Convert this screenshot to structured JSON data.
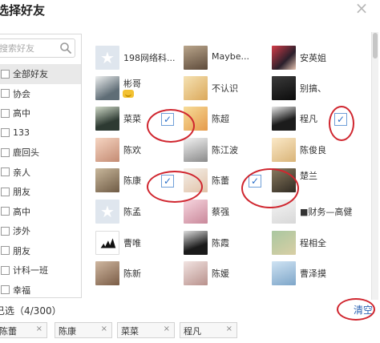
{
  "dialog": {
    "title": "选择好友",
    "close_label": "×"
  },
  "search": {
    "placeholder": "搜索好友"
  },
  "groups": [
    {
      "label": "全部好友"
    },
    {
      "label": "协会"
    },
    {
      "label": "高中"
    },
    {
      "label": "133"
    },
    {
      "label": "鹿回头"
    },
    {
      "label": "亲人"
    },
    {
      "label": "朋友"
    },
    {
      "label": "高中"
    },
    {
      "label": "涉外"
    },
    {
      "label": "朋友"
    },
    {
      "label": "计科一班"
    },
    {
      "label": "幸福"
    }
  ],
  "friends": [
    {
      "name": "198网络科..."
    },
    {
      "name": "Maybe..."
    },
    {
      "name": "安英姐"
    },
    {
      "name": "彬哥"
    },
    {
      "name": "不认识"
    },
    {
      "name": "别搞、"
    },
    {
      "name": "菜菜"
    },
    {
      "name": "陈超"
    },
    {
      "name": "程凡"
    },
    {
      "name": "陈欢"
    },
    {
      "name": "陈江波"
    },
    {
      "name": "陈俊良"
    },
    {
      "name": "陈康"
    },
    {
      "name": "陈蕾"
    },
    {
      "name": "楚兰"
    },
    {
      "name": "陈孟"
    },
    {
      "name": "蔡强"
    },
    {
      "name": "■财务—高健"
    },
    {
      "name": "曹唯"
    },
    {
      "name": "陈霞"
    },
    {
      "name": "程相全"
    },
    {
      "name": "陈新"
    },
    {
      "name": "陈媛"
    },
    {
      "name": "曹泽摸"
    }
  ],
  "checkmark": "✓",
  "selection": {
    "label": "已选（4/300）",
    "clear_label": "清空"
  },
  "chips": [
    {
      "label": "陈蕾",
      "remove": "×"
    },
    {
      "label": "陈康",
      "remove": "×"
    },
    {
      "label": "菜菜",
      "remove": "×"
    },
    {
      "label": "程凡",
      "remove": "×"
    }
  ],
  "colors": {
    "annotation": "#d0262f",
    "link": "#2d64b3",
    "checkmark": "#2a6fc9"
  }
}
